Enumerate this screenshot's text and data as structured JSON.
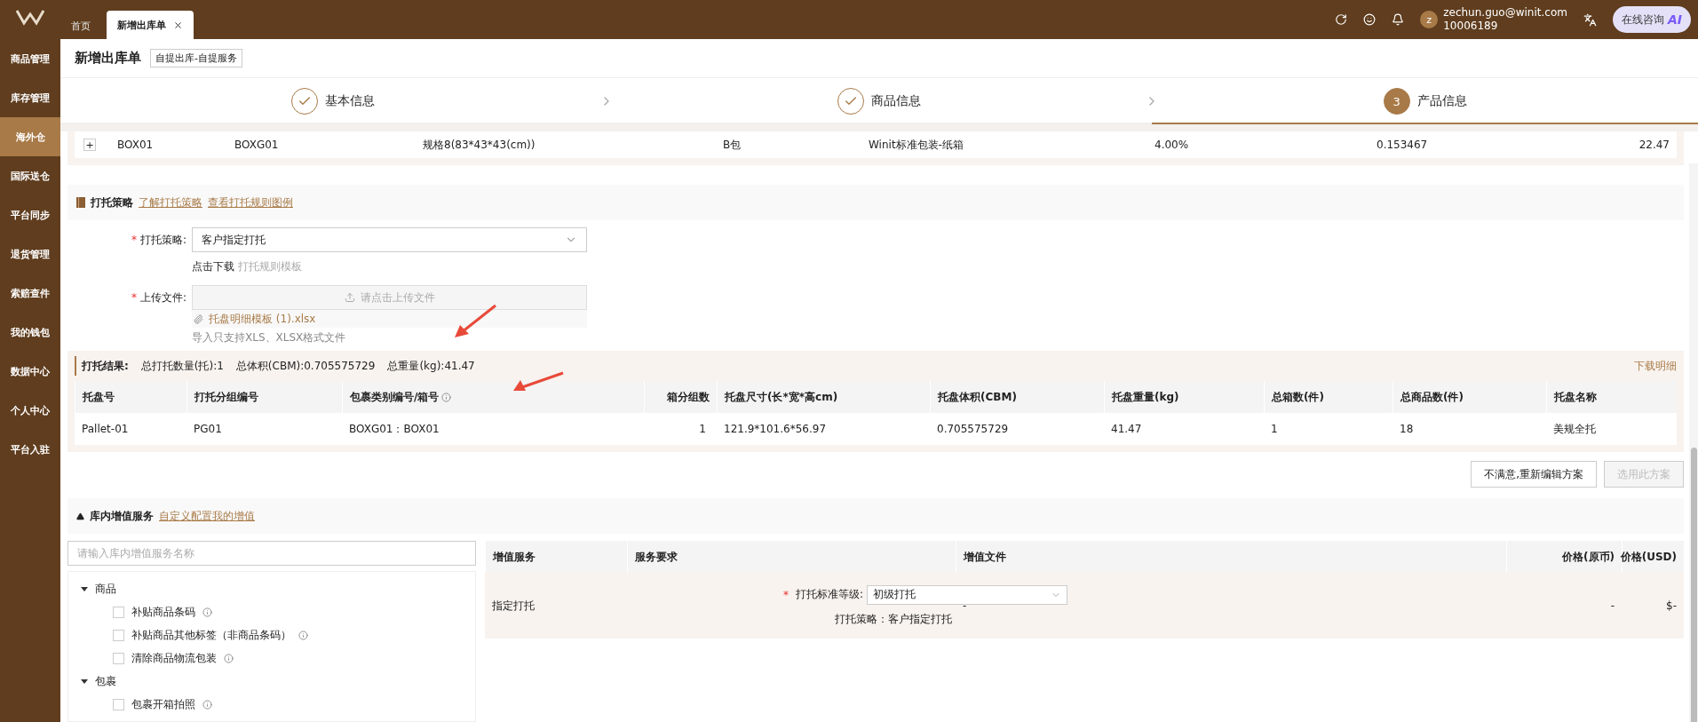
{
  "topbar": {
    "tabs": [
      {
        "label": "首页",
        "selected": false,
        "closable": false
      },
      {
        "label": "新增出库单",
        "selected": true,
        "closable": true
      }
    ],
    "user": {
      "avatar": "z",
      "email": "zechun.guo@winit.com",
      "id": "10006189"
    },
    "consult": {
      "label": "在线咨询",
      "badge": "AI"
    }
  },
  "sidebar": {
    "items": [
      {
        "label": "商品管理",
        "selected": false
      },
      {
        "label": "库存管理",
        "selected": false
      },
      {
        "label": "海外仓",
        "selected": true
      },
      {
        "label": "国际送仓",
        "selected": false
      },
      {
        "label": "平台同步",
        "selected": false
      },
      {
        "label": "退货管理",
        "selected": false
      },
      {
        "label": "索赔查件",
        "selected": false
      },
      {
        "label": "我的钱包",
        "selected": false
      },
      {
        "label": "数据中心",
        "selected": false
      },
      {
        "label": "个人中心",
        "selected": false
      },
      {
        "label": "平台入驻",
        "selected": false
      }
    ]
  },
  "page": {
    "title": "新增出库单",
    "tag": "自提出库-自提服务"
  },
  "steps": [
    {
      "label": "基本信息",
      "done": true,
      "selected": false
    },
    {
      "label": "商品信息",
      "done": true,
      "selected": false
    },
    {
      "label": "产品信息",
      "done": false,
      "selected": true,
      "number": "3"
    }
  ],
  "box_row": {
    "expand": "+",
    "cells": [
      "BOX01",
      "BOXG01",
      "规格8(83*43*43(cm))",
      "B包",
      "Winit标准包装-纸箱",
      "4.00%",
      "0.153467",
      "22.47"
    ]
  },
  "pallet_strategy": {
    "title": "打托策略",
    "links": [
      "了解打托策略",
      "查看打托规则图例"
    ],
    "required_mark": "*",
    "strategy_label": "打托策略:",
    "strategy_value": "客户指定打托",
    "download_prefix": "点击下载",
    "download_link": "打托规则模板",
    "upload_label": "上传文件:",
    "upload_placeholder": "请点击上传文件",
    "file_name": "托盘明细模板 (1).xlsx",
    "hint": "导入只支持XLS、XLSX格式文件"
  },
  "result": {
    "title": "打托结果:",
    "summary": [
      "总打托数量(托):1",
      "总体积(CBM):0.705575729",
      "总重量(kg):41.47"
    ],
    "download": "下载明细",
    "columns": [
      "托盘号",
      "打托分组编号",
      "包裹类别编号/箱号",
      "箱分组数",
      "托盘尺寸(长*宽*高cm)",
      "托盘体积(CBM)",
      "托盘重量(kg)",
      "总箱数(件)",
      "总商品数(件)",
      "托盘名称"
    ],
    "rows": [
      [
        "Pallet-01",
        "PG01",
        "BOXG01：BOX01",
        "1",
        "121.9*101.6*56.97",
        "0.705575729",
        "41.47",
        "1",
        "18",
        "美规全托"
      ]
    ]
  },
  "actions": [
    {
      "label": "不满意,重新编辑方案",
      "disabled": false
    },
    {
      "label": "选用此方案",
      "disabled": true
    }
  ],
  "value_added": {
    "title": "库内增值服务",
    "link": "自定义配置我的增值",
    "search_placeholder": "请输入库内增值服务名称",
    "tree": [
      {
        "label": "商品",
        "expanded": true,
        "children": [
          {
            "label": "补贴商品条码",
            "checked": false
          },
          {
            "label": "补贴商品其他标签（非商品条码）",
            "checked": false
          },
          {
            "label": "清除商品物流包装",
            "checked": false
          }
        ]
      },
      {
        "label": "包裹",
        "expanded": true,
        "children": [
          {
            "label": "包裹开箱拍照",
            "checked": false
          }
        ]
      }
    ],
    "columns": [
      "增值服务",
      "服务要求",
      "增值文件",
      "价格(原币)",
      "价格(USD)"
    ],
    "rows": [
      {
        "service": "指定打托",
        "required_mark": "*",
        "level_label": "打托标准等级:",
        "level_value": "初级打托",
        "strategy_text": "打托策略：客户指定打托",
        "file": "-",
        "price": "-",
        "usd": "$-"
      }
    ]
  }
}
